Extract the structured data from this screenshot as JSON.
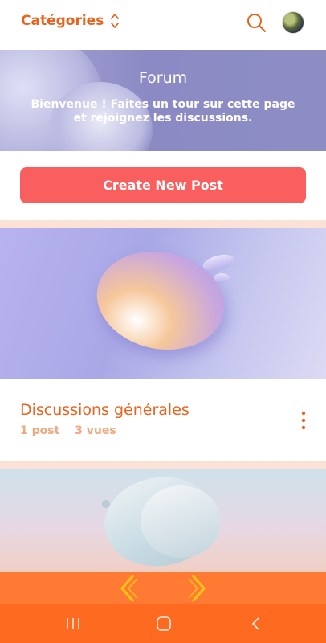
{
  "header": {
    "categories_label": "Catégories",
    "icons": [
      "updown-icon",
      "search-icon",
      "avatar"
    ]
  },
  "hero": {
    "title": "Forum",
    "subtitle": "Bienvenue ! Faites un tour sur cette page et rejoignez les discussions."
  },
  "actions": {
    "create_post_label": "Create New Post"
  },
  "categories": [
    {
      "name": "Discussions générales",
      "posts": "1 post",
      "views": "3 vues"
    }
  ],
  "colors": {
    "accent": "#e8641e",
    "button": "#fa5f5f",
    "muted_accent": "#f0a880",
    "separator": "#fbe1d6",
    "bottom_bar": "#ff7a33",
    "system_bar": "#ff6a21"
  },
  "bottom_nav": {
    "icons": [
      "chevron-left-icon",
      "chevron-right-icon"
    ]
  },
  "system_nav": {
    "icons": [
      "recent-apps-icon",
      "home-icon",
      "back-icon"
    ]
  }
}
